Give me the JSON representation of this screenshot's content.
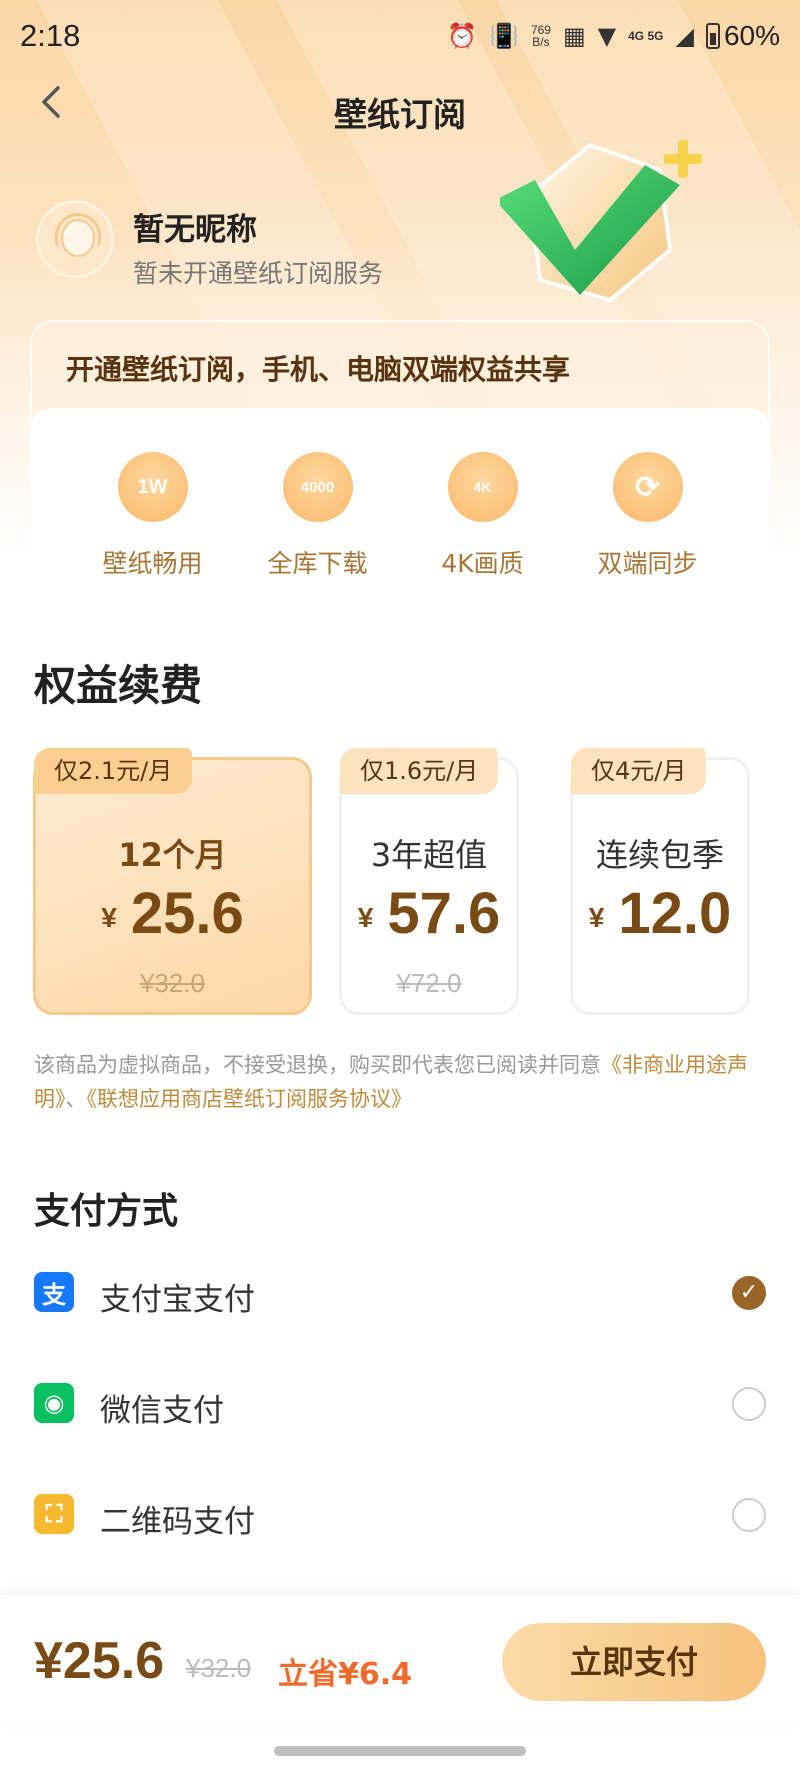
{
  "status_bar": {
    "time": "2:18",
    "speed_value": "769",
    "speed_unit": "B/s",
    "network": "4G 5G",
    "battery": "60%"
  },
  "header": {
    "title": "壁纸订阅",
    "back_icon": "chevron-left-icon"
  },
  "profile": {
    "name": "暂无昵称",
    "status": "暂未开通壁纸订阅服务"
  },
  "benefits": {
    "banner": "开通壁纸订阅，手机、电脑双端权益共享",
    "items": [
      {
        "icon_text": "1W",
        "label": "壁纸畅用"
      },
      {
        "icon_text": "4000",
        "label": "全库下载"
      },
      {
        "icon_text": "4K",
        "label": "4K画质"
      },
      {
        "icon_text": "⟳",
        "label": "双端同步"
      }
    ]
  },
  "plans": {
    "title": "权益续费",
    "currency": "¥",
    "items": [
      {
        "tag": "仅2.1元/月",
        "name": "12个月",
        "price": "25.6",
        "original": "¥32.0",
        "selected": true
      },
      {
        "tag": "仅1.6元/月",
        "name": "3年超值",
        "price": "57.6",
        "original": "¥72.0",
        "selected": false
      },
      {
        "tag": "仅4元/月",
        "name": "连续包季",
        "price": "12.0",
        "original": "",
        "selected": false
      }
    ]
  },
  "disclaimer": {
    "text": "该商品为虚拟商品，不接受退换，购买即代表您已阅读并同意",
    "link1": "《非商业用途声明》",
    "sep": "、",
    "link2": "《联想应用商店壁纸订阅服务协议》"
  },
  "payment": {
    "title": "支付方式",
    "methods": [
      {
        "label": "支付宝支付",
        "icon": "alipay-icon",
        "glyph": "支",
        "color": "#1677ff",
        "checked": true
      },
      {
        "label": "微信支付",
        "icon": "wechat-icon",
        "glyph": "◉",
        "color": "#07c160",
        "checked": false
      },
      {
        "label": "二维码支付",
        "icon": "qrcode-icon",
        "glyph": "⛶",
        "color": "#f5b82e",
        "checked": false
      }
    ]
  },
  "checkout": {
    "total": "¥25.6",
    "original": "¥32.0",
    "saving": "立省¥6.4",
    "button": "立即支付"
  }
}
